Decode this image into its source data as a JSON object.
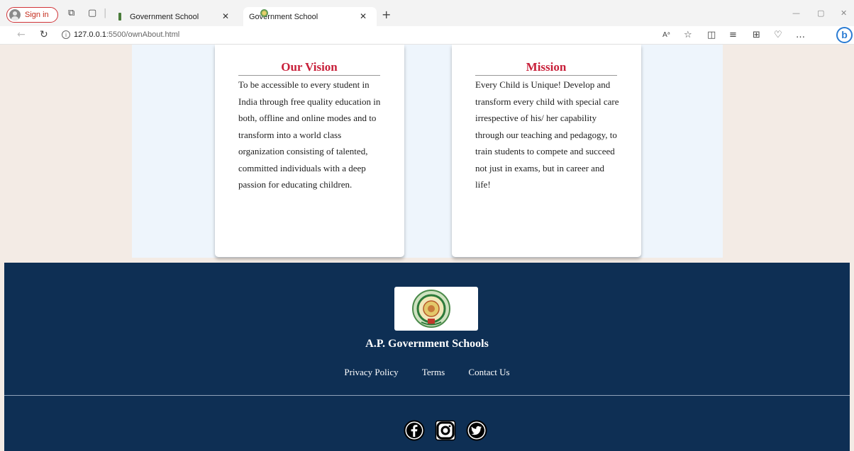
{
  "browser": {
    "signin_label": "Sign in",
    "tabs": [
      {
        "title": "Government School"
      },
      {
        "title": "Government School"
      }
    ],
    "url_host": "127.0.0.1",
    "url_path": ":5500/ownAbout.html"
  },
  "vision": {
    "title": "Our Vision",
    "text": "To be accessible to every student in India through free quality education in both, offline and online modes and to transform into a world class organization consisting of talented, committed individuals with a deep passion for educating children."
  },
  "mission": {
    "title": "Mission",
    "text": "Every Child is Unique! Develop and transform every child with special care irrespective of his/ her capability through our teaching and pedagogy, to train students to compete and succeed not just in exams, but in career and life!"
  },
  "footer": {
    "title": "A.P. Government Schools",
    "links": [
      "Privacy Policy",
      "Terms",
      "Contact Us"
    ],
    "socials": [
      "facebook-icon",
      "instagram-icon",
      "twitter-icon"
    ]
  },
  "colors": {
    "heading_red": "#c8203a",
    "footer_navy": "#0e2f54",
    "content_bg": "#eef5fc",
    "page_bg": "#f3ebe5"
  }
}
